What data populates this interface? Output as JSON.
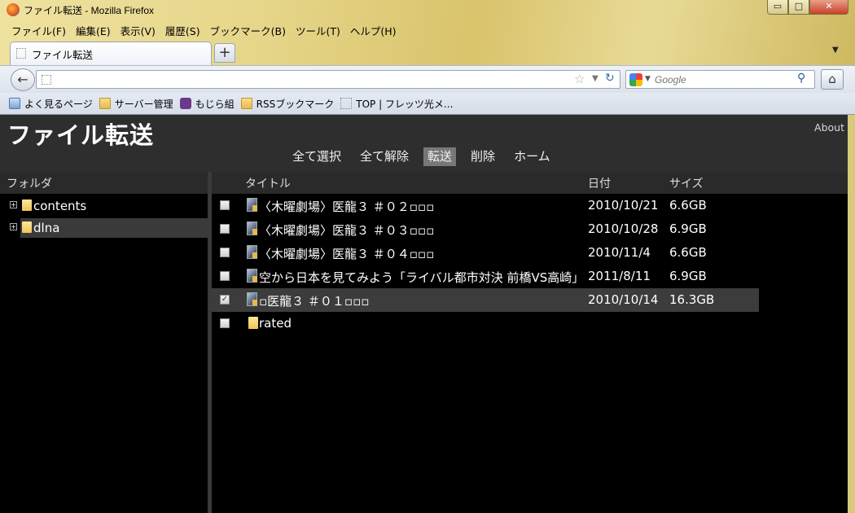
{
  "window": {
    "title": "ファイル転送 - Mozilla Firefox",
    "min_glyph": "▭",
    "max_glyph": "□",
    "close_glyph": "✕"
  },
  "menu": [
    "ファイル(F)",
    "編集(E)",
    "表示(V)",
    "履歴(S)",
    "ブックマーク(B)",
    "ツール(T)",
    "ヘルプ(H)"
  ],
  "tab": {
    "label": "ファイル転送",
    "new_glyph": "+",
    "list_glyph": "▼"
  },
  "nav": {
    "back_glyph": "←",
    "url_value": "",
    "star_glyph": "☆",
    "drop_glyph": "▼",
    "reload_glyph": "↻",
    "search_placeholder": "Google",
    "search_drop_glyph": "▼",
    "search_glyph": "⚲",
    "home_glyph": "⌂"
  },
  "bookmarks": [
    {
      "label": "よく見るページ",
      "icon": "most-visited-icon"
    },
    {
      "label": "サーバー管理",
      "icon": "folder-icon"
    },
    {
      "label": "もじら組",
      "icon": "mojira-icon"
    },
    {
      "label": "RSSブックマーク",
      "icon": "folder-icon"
    },
    {
      "label": "TOP | フレッツ光メ...",
      "icon": "page-icon"
    }
  ],
  "page": {
    "title": "ファイル転送",
    "about": "About",
    "toolbar": {
      "select_all": "全て選択",
      "deselect_all": "全て解除",
      "transfer": "転送",
      "delete": "削除",
      "home": "ホーム"
    },
    "columns": {
      "folder": "フォルダ",
      "title": "タイトル",
      "date": "日付",
      "size": "サイズ"
    },
    "folders": [
      {
        "name": "contents",
        "expander": "+"
      },
      {
        "name": "dlna",
        "expander": "+"
      }
    ],
    "files": [
      {
        "title": "〈木曜劇場〉医龍３ ＃０２▫▫▫",
        "date": "2010/10/21",
        "size": "6.6GB",
        "checked": false,
        "type": "video"
      },
      {
        "title": "〈木曜劇場〉医龍３ ＃０３▫▫▫",
        "date": "2010/10/28",
        "size": "6.9GB",
        "checked": false,
        "type": "video"
      },
      {
        "title": "〈木曜劇場〉医龍３ ＃０４▫▫▫",
        "date": "2010/11/4",
        "size": "6.6GB",
        "checked": false,
        "type": "video"
      },
      {
        "title": "空から日本を見てみよう「ライバル都市対決 前橋VS高崎」",
        "date": "2011/8/11",
        "size": "6.9GB",
        "checked": false,
        "type": "video"
      },
      {
        "title": "▫医龍３ ＃０１▫▫▫",
        "date": "2010/10/14",
        "size": "16.3GB",
        "checked": true,
        "type": "video"
      },
      {
        "title": "rated",
        "date": "",
        "size": "",
        "checked": false,
        "type": "folder"
      }
    ],
    "check_glyph": "✓"
  }
}
